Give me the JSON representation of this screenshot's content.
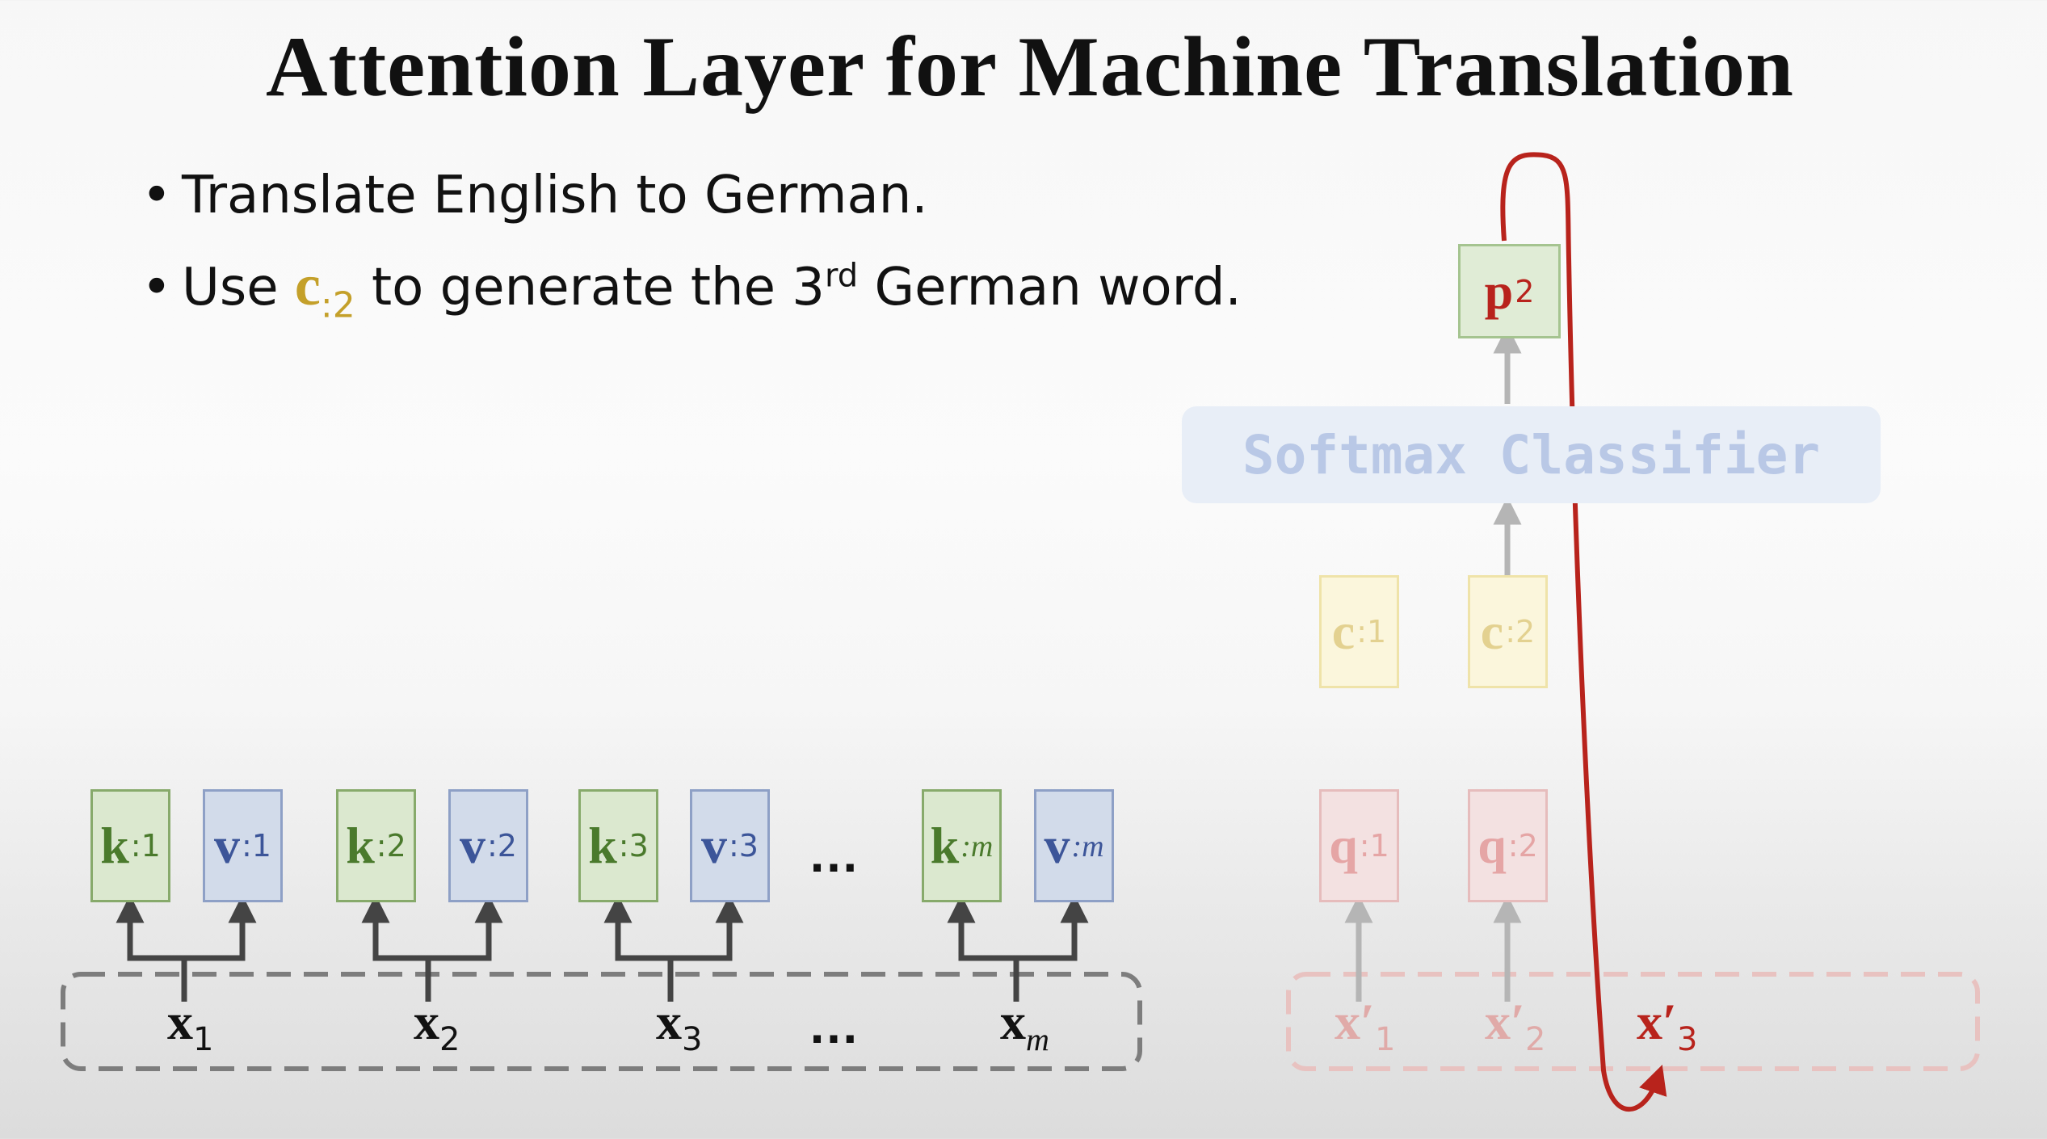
{
  "slide": {
    "title": "Attention Layer for Machine Translation",
    "bullets": {
      "b1": "Translate English to German.",
      "b2_pre": "Use ",
      "b2_vec": "c",
      "b2_sub": ":2",
      "b2_mid": " to generate the 3",
      "b2_sup": "rd",
      "b2_post": " German word."
    }
  },
  "encoder": {
    "pairs": [
      {
        "k": "k",
        "k_sub": ":1",
        "v": "v",
        "v_sub": ":1",
        "x": "x",
        "x_sub": "1"
      },
      {
        "k": "k",
        "k_sub": ":2",
        "v": "v",
        "v_sub": ":2",
        "x": "x",
        "x_sub": "2"
      },
      {
        "k": "k",
        "k_sub": ":3",
        "v": "v",
        "v_sub": ":3",
        "x": "x",
        "x_sub": "3"
      },
      {
        "k": "k",
        "k_sub": ":m",
        "v": "v",
        "v_sub": ":m",
        "x": "x",
        "x_sub": "m"
      }
    ],
    "ellipsis": "…"
  },
  "decoder": {
    "c": [
      {
        "sym": "c",
        "sub": ":1"
      },
      {
        "sym": "c",
        "sub": ":2"
      }
    ],
    "q": [
      {
        "sym": "q",
        "sub": ":1"
      },
      {
        "sym": "q",
        "sub": ":2"
      }
    ],
    "x": [
      {
        "sym": "x′",
        "sub": "1"
      },
      {
        "sym": "x′",
        "sub": "2"
      },
      {
        "sym": "x′",
        "sub": "3"
      }
    ],
    "classifier": "Softmax Classifier",
    "p": {
      "sym": "p",
      "sub": "2"
    }
  },
  "colors": {
    "key_green": "#4a7a2c",
    "value_blue": "#3c5599",
    "context_gold": "#c4a02a",
    "query_pink": "#e5a5a5",
    "feedback_red": "#b8231c"
  }
}
